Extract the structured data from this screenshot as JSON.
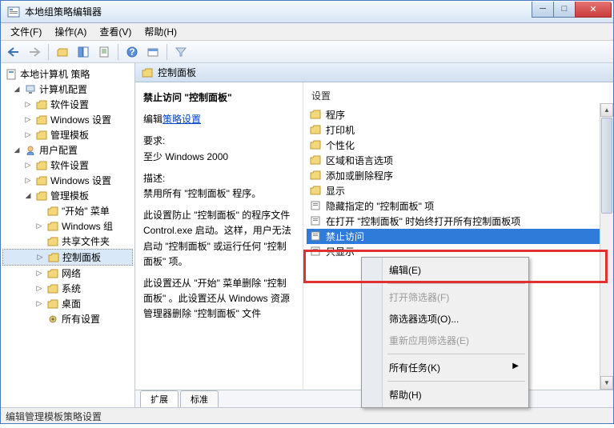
{
  "window": {
    "title": "本地组策略编辑器"
  },
  "menubar": {
    "file": "文件(F)",
    "action": "操作(A)",
    "view": "查看(V)",
    "help": "帮助(H)"
  },
  "tree": {
    "root": "本地计算机 策略",
    "computer_config": "计算机配置",
    "software_settings": "软件设置",
    "windows_settings": "Windows 设置",
    "admin_templates": "管理模板",
    "user_config": "用户配置",
    "start_menu": "\"开始\" 菜单",
    "windows_components": "Windows 组",
    "shared_folders": "共享文件夹",
    "control_panel": "控制面板",
    "network": "网络",
    "system": "系统",
    "desktop": "桌面",
    "all_settings": "所有设置"
  },
  "path": {
    "current": "控制面板"
  },
  "description": {
    "title": "禁止访问 \"控制面板\"",
    "edit_prefix": "编辑",
    "edit_link": "策略设置",
    "req_label": "要求:",
    "req_value": "至少 Windows 2000",
    "desc_label": "描述:",
    "desc_p1": "禁用所有 \"控制面板\" 程序。",
    "desc_p2": "此设置防止 \"控制面板\" 的程序文件 Control.exe 启动。这样，用户无法启动 \"控制面板\" 或运行任何 \"控制面板\" 项。",
    "desc_p3": "此设置还从 \"开始\" 菜单删除 \"控制面板\" 。此设置还从 Windows 资源管理器删除 \"控制面板\" 文件"
  },
  "settings": {
    "header": "设置",
    "items": [
      "程序",
      "打印机",
      "个性化",
      "区域和语言选项",
      "添加或删除程序",
      "显示",
      "隐藏指定的 \"控制面板\" 项",
      "在打开 \"控制面板\" 时始终打开所有控制面板项",
      "禁止访问",
      "只显示"
    ]
  },
  "tabs": {
    "extended": "扩展",
    "standard": "标准"
  },
  "context_menu": {
    "edit": "编辑(E)",
    "open_filter": "打开筛选器(F)",
    "filter_options": "筛选器选项(O)...",
    "reapply_filter": "重新应用筛选器(E)",
    "all_tasks": "所有任务(K)",
    "help": "帮助(H)"
  },
  "statusbar": {
    "text": "编辑管理模板策略设置"
  }
}
